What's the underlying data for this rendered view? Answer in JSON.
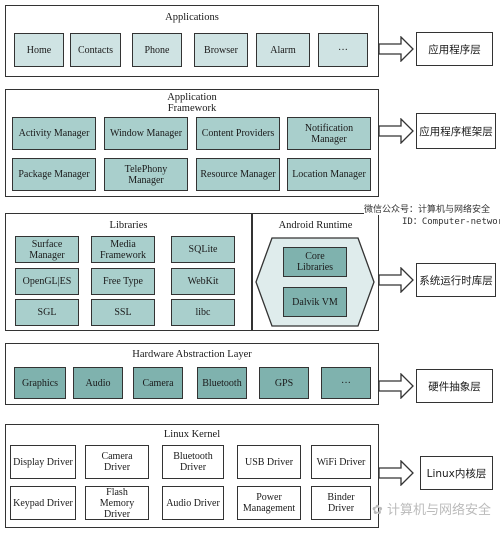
{
  "layers": [
    {
      "title": "Applications",
      "label": "应用程序层",
      "items": [
        "Home",
        "Contacts",
        "Phone",
        "Browser",
        "Alarm",
        "···"
      ]
    },
    {
      "title": "Application Framework",
      "title_lines": [
        "Application",
        "Framework"
      ],
      "label": "应用程序框架层",
      "items": [
        "Activity Manager",
        "Window Manager",
        "Content Providers",
        "Notification Manager",
        "Package Manager",
        "TelePhony Manager",
        "Resource Manager",
        "Location Manager"
      ]
    },
    {
      "title": "Libraries",
      "label": "系统运行时库层",
      "items": [
        "Surface Manager",
        "Media Framework",
        "SQLite",
        "OpenGL|ES",
        "Free Type",
        "WebKit",
        "SGL",
        "SSL",
        "libc"
      ],
      "runtime": {
        "title": "Android Runtime",
        "items": [
          "Core Libraries",
          "Dalvik VM"
        ]
      }
    },
    {
      "title": "Hardware Abstraction Layer",
      "label": "硬件抽象层",
      "items": [
        "Graphics",
        "Audio",
        "Camera",
        "Bluetooth",
        "GPS",
        "···"
      ]
    },
    {
      "title": "Linux Kernel",
      "label": "Linux内核层",
      "items": [
        "Display Driver",
        "Camera Driver",
        "Bluetooth Driver",
        "USB Driver",
        "WiFi Driver",
        "Keypad Driver",
        "Flash Memory Driver",
        "Audio Driver",
        "Power Management",
        "Binder Driver"
      ]
    }
  ],
  "watermark": {
    "line1": "微信公众号：计算机与网络安全",
    "line2": "ID：Computer-network",
    "bottom": "计算机与网络安全"
  },
  "colors": {
    "light": "#cfe3e3",
    "mid": "#a9cfcc",
    "dark": "#7fb2ae",
    "border": "#333333"
  }
}
